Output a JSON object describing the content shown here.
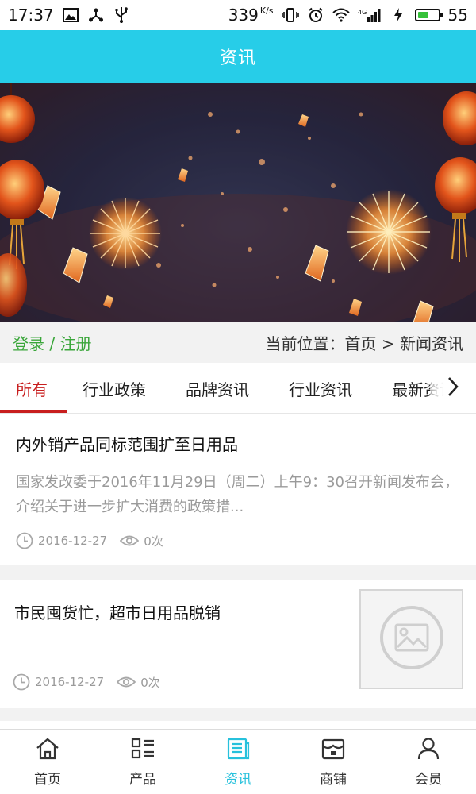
{
  "status_bar": {
    "time": "17:37",
    "net_speed": "339",
    "net_speed_unit": "K/s",
    "network_type": "4G",
    "battery_level": "55",
    "battery_fraction": 0.55,
    "left_icons": [
      "image-icon",
      "share-icon",
      "usb-icon"
    ],
    "right_icons": [
      "vibrate-icon",
      "alarm-icon",
      "wifi-icon",
      "signal-icon",
      "charging-icon",
      "battery-icon"
    ]
  },
  "header": {
    "title": "资讯"
  },
  "location_bar": {
    "login_text": "登录 / 注册",
    "breadcrumb": "当前位置：首页 > 新闻资讯"
  },
  "tabs": [
    {
      "label": "所有",
      "active": true
    },
    {
      "label": "行业政策",
      "active": false
    },
    {
      "label": "品牌资讯",
      "active": false
    },
    {
      "label": "行业资讯",
      "active": false
    },
    {
      "label": "最新资讯",
      "active": false
    }
  ],
  "articles": [
    {
      "title": "内外销产品同标范围扩至日用品",
      "summary": "国家发改委于2016年11月29日（周二）上午9：30召开新闻发布会，介绍关于进一步扩大消费的政策措...",
      "date": "2016-12-27",
      "views": "0次"
    },
    {
      "title": "市民囤货忙，超市日用品脱销",
      "date": "2016-12-27",
      "views": "0次",
      "thumbnail": "image-placeholder-icon"
    }
  ],
  "bottom_nav": [
    {
      "label": "首页",
      "icon": "home-icon",
      "active": false
    },
    {
      "label": "产品",
      "icon": "product-grid-icon",
      "active": false
    },
    {
      "label": "资讯",
      "icon": "news-icon",
      "active": true
    },
    {
      "label": "商铺",
      "icon": "store-icon",
      "active": false
    },
    {
      "label": "会员",
      "icon": "user-icon",
      "active": false
    }
  ],
  "colors": {
    "header_bg": "#27cde8",
    "active_tab": "#c81e1e",
    "login_green": "#3aa63a",
    "nav_active": "#27c1dc"
  }
}
